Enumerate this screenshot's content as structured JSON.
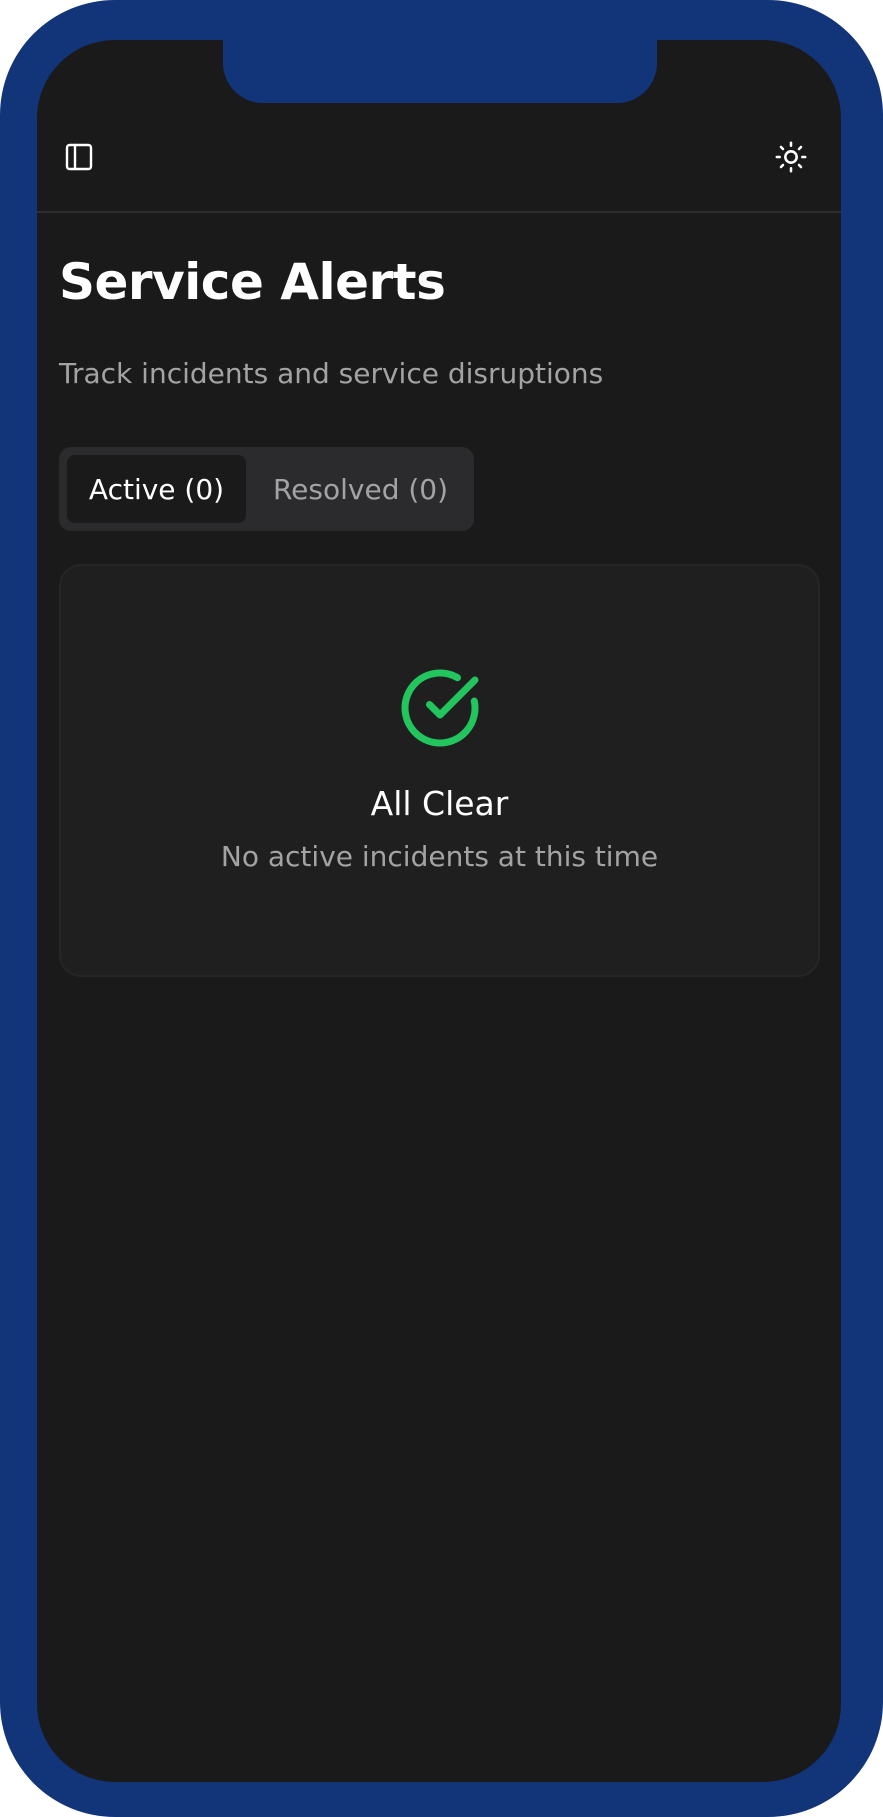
{
  "header": {
    "sidebar_toggle_icon": "sidebar-panel-icon",
    "theme_toggle_icon": "sun-icon"
  },
  "page": {
    "title": "Service Alerts",
    "subtitle": "Track incidents and service disruptions"
  },
  "tabs": [
    {
      "label": "Active (0)",
      "selected": true
    },
    {
      "label": "Resolved (0)",
      "selected": false
    }
  ],
  "empty_state": {
    "icon": "check-circle-icon",
    "title": "All Clear",
    "message": "No active incidents at this time"
  },
  "colors": {
    "frame": "#12357a",
    "background": "#1a1a1a",
    "card": "#1f1f1f",
    "success": "#22c55e",
    "muted_text": "#a3a3a3"
  }
}
